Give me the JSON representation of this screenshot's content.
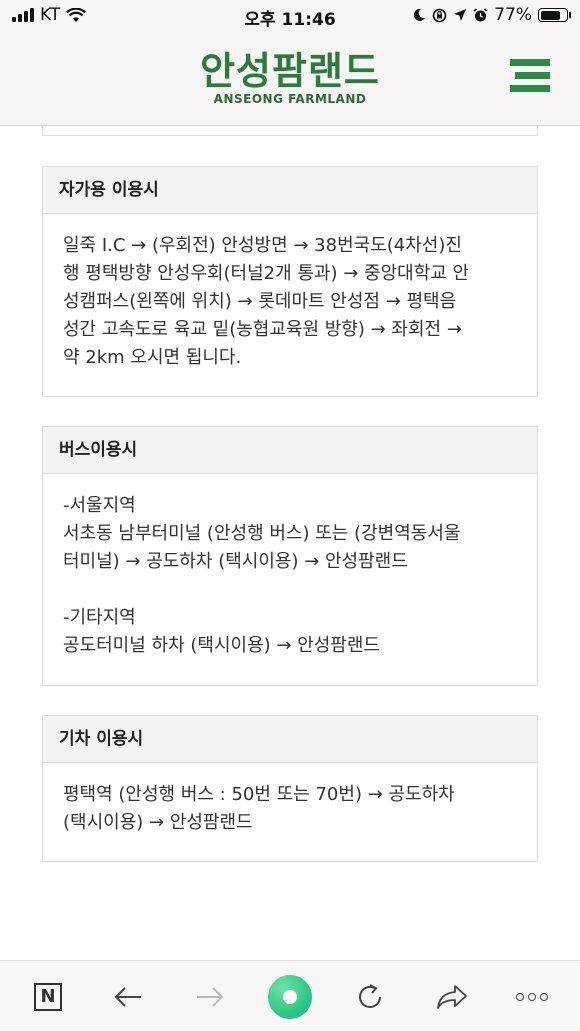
{
  "status_bar": {
    "carrier": "KT",
    "time": "오후 11:46",
    "battery": "77%",
    "battery_level": 0.77,
    "icons": [
      "signal-icon",
      "wifi-icon",
      "moon-icon",
      "rotation-lock-icon",
      "location-icon",
      "alarm-icon",
      "battery-icon"
    ]
  },
  "header": {
    "logo_ko": "안성팜랜드",
    "logo_en": "ANSEONG FARMLAND",
    "menu_icon": "hamburger-menu-icon"
  },
  "sections": [
    {
      "title": "자가용 이용시",
      "body": "일죽 I.C → (우회전) 안성방면 → 38번국도(4차선)진\n행 평택방향 안성우회(터널2개 통과) → 중앙대학교 안\n성캠퍼스(왼쪽에 위치) → 롯데마트 안성점 → 평택음\n성간 고속도로 육교 밑(농협교육원 방향) → 좌회전 →\n약 2km 오시면 됩니다."
    },
    {
      "title": "버스이용시",
      "body": "-서울지역\n서초동 남부터미널 (안성행 버스) 또는 (강변역동서울\n터미널) → 공도하차 (택시이용) → 안성팜랜드\n\n-기타지역\n공도터미널 하차 (택시이용) → 안성팜랜드"
    },
    {
      "title": "기차 이용시",
      "body": "평택역 (안성행 버스 : 50번 또는 70번) → 공도하차\n(택시이용) → 안성팜랜드"
    }
  ],
  "toolbar": {
    "icons": [
      "naver-n-icon",
      "back-arrow-icon",
      "forward-arrow-icon",
      "green-dot-icon",
      "refresh-icon",
      "share-icon",
      "more-icon"
    ],
    "n_label": "N"
  },
  "colors": {
    "brand_green": "#2c7a3c",
    "menu_green": "#2c8a44",
    "box_border": "#dcdcdc",
    "box_header_bg": "#f3f3f3"
  }
}
